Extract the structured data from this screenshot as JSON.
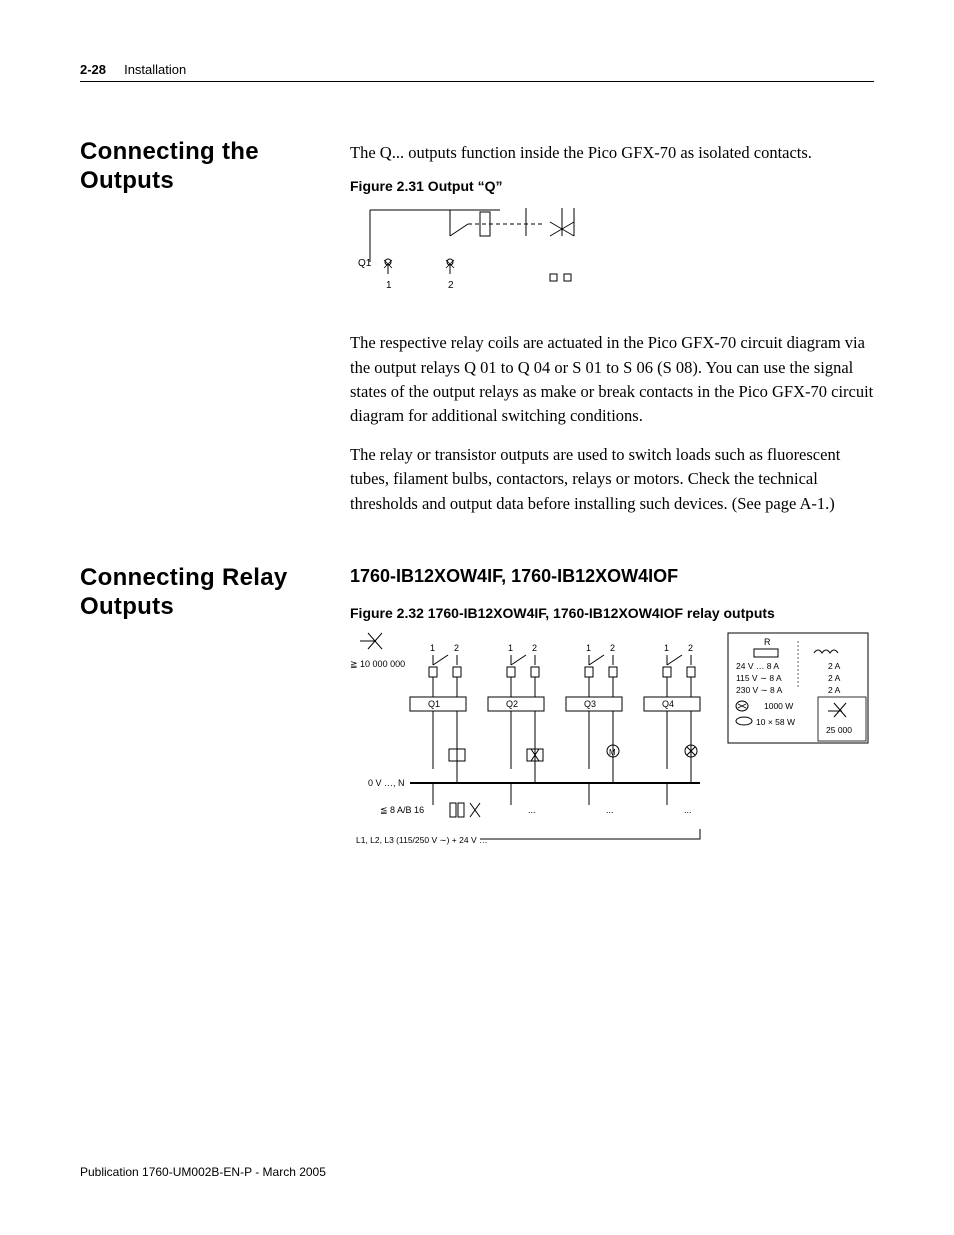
{
  "header": {
    "page_number": "2-28",
    "chapter": "Installation"
  },
  "section1": {
    "title": "Connecting the Outputs",
    "intro": "The Q... outputs function inside the Pico GFX-70 as isolated contacts.",
    "figure_caption": "Figure 2.31 Output “Q”",
    "figure": {
      "q_label": "Q1",
      "terminal_1": "1",
      "terminal_2": "2"
    },
    "para1": "The respective relay coils are actuated in the Pico GFX-70 circuit diagram via the output relays Q 01 to Q 04 or S 01 to S 06 (S 08). You can use the signal states of the output relays as make or break contacts in the Pico GFX-70 circuit diagram for additional switching conditions.",
    "para2": "The relay or transistor outputs are used to switch loads such as fluorescent tubes, filament bulbs, contactors, relays or motors. Check the technical thresholds and output data before installing such devices. (See page A-1.)"
  },
  "section2": {
    "title": "Connecting Relay Outputs",
    "h2": "1760-IB12XOW4IF, 1760-IB12XOW4IOF",
    "figure_caption": "Figure 2.32 1760-IB12XOW4IF, 1760-IB12XOW4IOF relay outputs",
    "figure": {
      "life_cycles": "≧ 10 000 000",
      "relay_labels": [
        "Q1",
        "Q2",
        "Q3",
        "Q4"
      ],
      "terminal_1": "1",
      "terminal_2": "2",
      "zero_v": "0 V …, N",
      "fuse": "≦ 8 A/B 16",
      "dots": "...",
      "supply": "L1, L2, L3 (115/250 V ∼)\n+ 24 V …",
      "rating_box": {
        "R": "R",
        "rows": [
          {
            "left": "24 V …  8 A",
            "right": "2 A"
          },
          {
            "left": "115 V ∼  8 A",
            "right": "2 A"
          },
          {
            "left": "230 V ∼  8 A",
            "right": "2 A"
          }
        ],
        "lamp_row1": "1000 W",
        "lamp_row2": "10 × 58 W",
        "starter_cycles": "25 000"
      }
    }
  },
  "footer": "Publication 1760-UM002B-EN-P - March 2005"
}
